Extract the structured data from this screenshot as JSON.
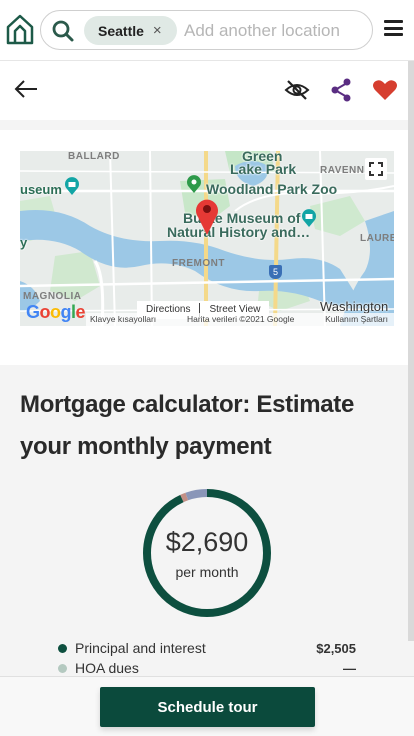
{
  "header": {
    "search_chip": "Seattle",
    "chip_remove": "×",
    "search_placeholder": "Add another location"
  },
  "map": {
    "labels": {
      "ballard": "BALLARD",
      "green_lake": "Green",
      "green_lake_park": "Lake Park",
      "ravenna": "RAVENNA",
      "museum_left": "useum",
      "zoo": "Woodland Park Zoo",
      "burke_1": "Burke Museum of",
      "burke_2": "Natural History and…",
      "fremont": "FREMONT",
      "laurel": "LAURE",
      "magnolia": "MAGNOLIA",
      "washington": "Washington",
      "route": "5",
      "left_edge": "y"
    },
    "buttons": {
      "directions": "Directions",
      "street_view": "Street View"
    },
    "google": "Google",
    "attribution_left": "Klavye kısayolları",
    "attribution_mid": "Harita verileri ©2021 Google",
    "attribution_right": "Kullanım Şartları"
  },
  "mortgage": {
    "title": "Mortgage calculator: Estimate your monthly payment",
    "amount": "$2,690",
    "per_month": "per month",
    "breakdown": [
      {
        "label": "Principal and interest",
        "value": "$2,505",
        "color": "#0d4f3f"
      },
      {
        "label": "HOA dues",
        "value": "—",
        "color": "#b4c9c0"
      }
    ],
    "segments": [
      {
        "name": "Principal and interest",
        "fraction": 0.931,
        "color": "#0d4f3f"
      },
      {
        "name": "segment-2",
        "fraction": 0.014,
        "color": "#c28f85"
      },
      {
        "name": "segment-3",
        "fraction": 0.055,
        "color": "#8a96b8"
      }
    ]
  },
  "footer": {
    "cta": "Schedule tour"
  },
  "colors": {
    "brand": "#0b4a3c",
    "heart": "#d63e2f",
    "share": "#5a2d82"
  }
}
